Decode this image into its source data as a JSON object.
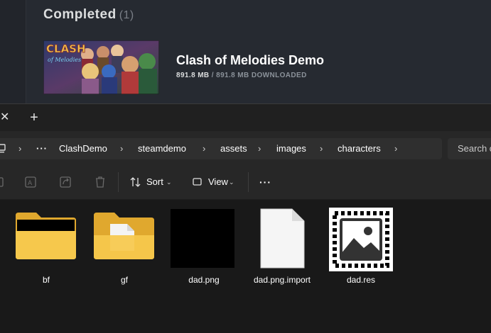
{
  "steam": {
    "section_title": "Completed",
    "section_count": "(1)",
    "game": {
      "title": "Clash of Melodies Demo",
      "size_done": "891.8 MB",
      "size_total": "/ 891.8 MB DOWNLOADED",
      "cover_logo_line1": "CLASH",
      "cover_logo_line2": "of Melodies"
    }
  },
  "explorer": {
    "tab": {
      "close_glyph": "✕",
      "add_glyph": "+"
    },
    "breadcrumb": [
      "ClashDemo",
      "steamdemo",
      "assets",
      "images",
      "characters"
    ],
    "more_glyph": "···",
    "search_placeholder": "Search c",
    "toolbar": {
      "sort_label": "Sort",
      "view_label": "View",
      "more_glyph": "···"
    },
    "items": [
      {
        "name": "bf",
        "type": "folder-dark"
      },
      {
        "name": "gf",
        "type": "folder-doc"
      },
      {
        "name": "dad.png",
        "type": "image-black"
      },
      {
        "name": "dad.png.import",
        "type": "file-blank"
      },
      {
        "name": "dad.res",
        "type": "image-placeholder"
      }
    ]
  },
  "colors": {
    "steam_bg": "#262a31",
    "explorer_bg": "#191919",
    "toolbar_bg": "#272727",
    "folder_yellow": "#f3c84a"
  }
}
